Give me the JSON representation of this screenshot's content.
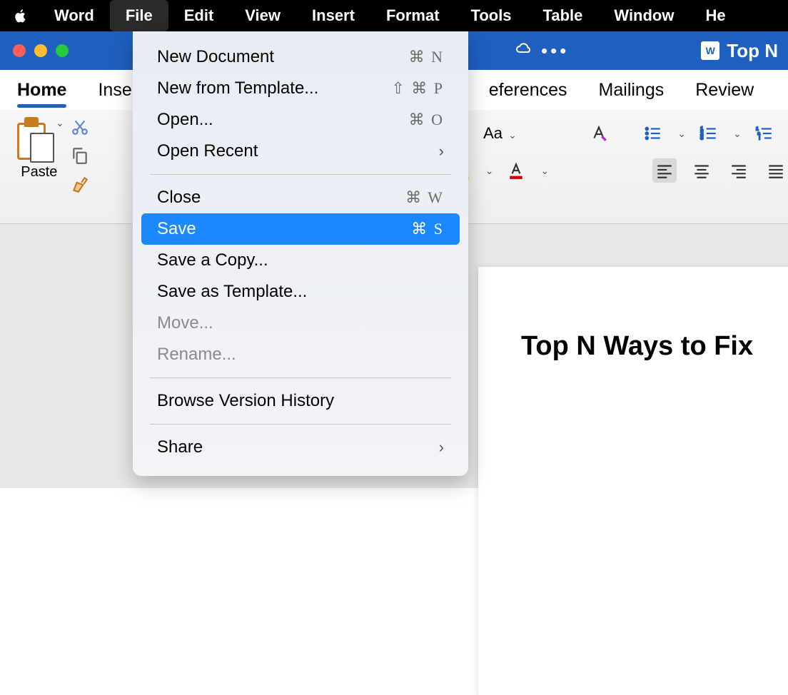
{
  "menubar": {
    "app": "Word",
    "items": [
      "File",
      "Edit",
      "View",
      "Insert",
      "Format",
      "Tools",
      "Table",
      "Window",
      "He"
    ]
  },
  "titlebar": {
    "doc_title": "Top N"
  },
  "ribbon_tabs": [
    "Home",
    "Inse",
    "eferences",
    "Mailings",
    "Review"
  ],
  "ribbon": {
    "paste_label": "Paste",
    "font_size_hint": "Aa"
  },
  "dropdown": {
    "items": [
      {
        "label": "New Document",
        "shortcut": "⌘ N",
        "state": "normal"
      },
      {
        "label": "New from Template...",
        "shortcut": "⇧ ⌘ P",
        "state": "normal"
      },
      {
        "label": "Open...",
        "shortcut": "⌘ O",
        "state": "normal"
      },
      {
        "label": "Open Recent",
        "shortcut": "",
        "state": "submenu"
      }
    ],
    "items2": [
      {
        "label": "Close",
        "shortcut": "⌘ W",
        "state": "normal"
      },
      {
        "label": "Save",
        "shortcut": "⌘ S",
        "state": "highlight"
      },
      {
        "label": "Save a Copy...",
        "shortcut": "",
        "state": "normal"
      },
      {
        "label": "Save as Template...",
        "shortcut": "",
        "state": "normal"
      },
      {
        "label": "Move...",
        "shortcut": "",
        "state": "disabled"
      },
      {
        "label": "Rename...",
        "shortcut": "",
        "state": "disabled"
      }
    ],
    "items3": [
      {
        "label": "Browse Version History",
        "shortcut": "",
        "state": "normal"
      }
    ],
    "items4": [
      {
        "label": "Share",
        "shortcut": "",
        "state": "submenu"
      }
    ]
  },
  "document": {
    "heading": "Top N Ways to Fix"
  }
}
